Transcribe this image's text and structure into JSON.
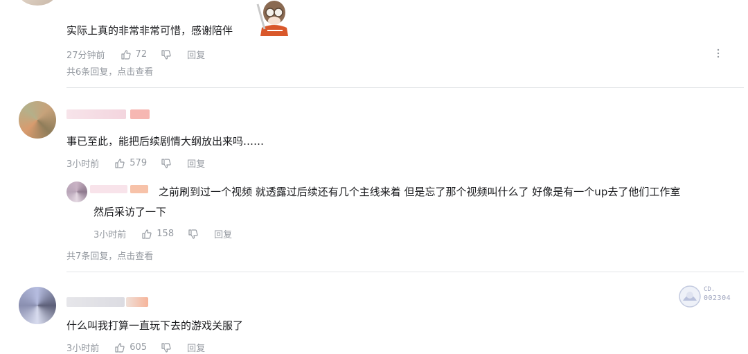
{
  "comments": [
    {
      "content": "实际上真的非常非常可惜，感谢陪伴",
      "time": "27分钟前",
      "likes": "72",
      "reply_label": "回复",
      "more_replies": "共6条回复，点击查看"
    },
    {
      "content": "事已至此，能把后续剧情大纲放出来吗……",
      "time": "3小时前",
      "likes": "579",
      "reply_label": "回复",
      "sub_reply": {
        "content_line1": "之前刷到过一个视频 就透露过后续还有几个主线来着 但是忘了那个视频叫什么了 好像是有一个up去了他们工作室",
        "content_line2": "然后采访了一下",
        "time": "3小时前",
        "likes": "158",
        "reply_label": "回复"
      },
      "more_replies": "共7条回复，点击查看"
    },
    {
      "content": "什么叫我打算一直玩下去的游戏关服了",
      "time": "3小时前",
      "likes": "605",
      "reply_label": "回复",
      "badge_text_top": "CD.",
      "badge_text_bottom": "002304"
    }
  ],
  "colors": {
    "text": "#18191c",
    "meta": "#9499a0",
    "divider": "#e3e5e7",
    "accent_pink": "#fb7299"
  },
  "icons": {
    "like": "thumb-up-icon",
    "dislike": "thumb-down-icon",
    "more": "more-vertical-icon"
  }
}
